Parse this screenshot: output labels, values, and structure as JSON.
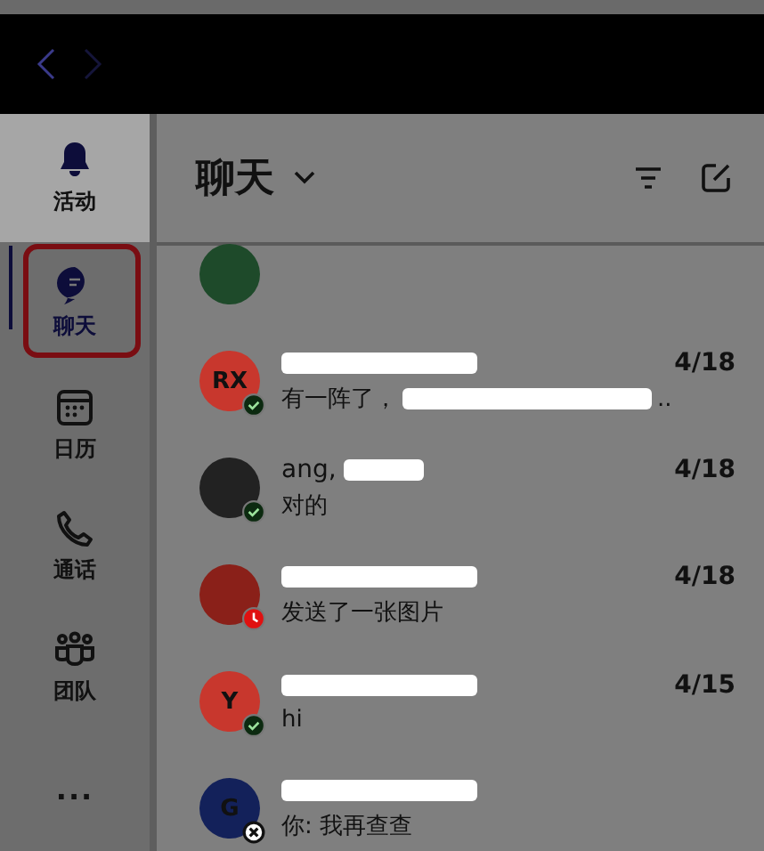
{
  "rail": [
    {
      "kind": "bell",
      "label": "活动",
      "selected": false,
      "highlighted": true
    },
    {
      "kind": "chat",
      "label": "聊天",
      "selected": true,
      "highlighted": false
    },
    {
      "kind": "calendar",
      "label": "日历",
      "selected": false,
      "highlighted": false
    },
    {
      "kind": "phone",
      "label": "通话",
      "selected": false,
      "highlighted": false
    },
    {
      "kind": "team",
      "label": "团队",
      "selected": false,
      "highlighted": false
    },
    {
      "kind": "more",
      "label": "...",
      "selected": false,
      "highlighted": false
    }
  ],
  "header": {
    "title": "聊天"
  },
  "chats": [
    {
      "initials": "RX",
      "color": "#c8372d",
      "badge": {
        "kind": "available"
      },
      "preview": "有一阵了，",
      "preview_tail": "..",
      "date": "4/18"
    },
    {
      "name": "ang,",
      "color": "#222222",
      "badge": {
        "kind": "available"
      },
      "preview": "对的",
      "date": "4/18"
    },
    {
      "color": "#8a2019",
      "badge": {
        "kind": "away"
      },
      "preview": "发送了一张图片",
      "date": "4/18"
    },
    {
      "initials": "Y",
      "color": "#c8372d",
      "badge": {
        "kind": "available"
      },
      "preview": "hi",
      "date": "4/15"
    },
    {
      "initials": "G",
      "color": "#13215a",
      "badge": {
        "kind": "offline"
      },
      "preview": "你: 我再查查"
    }
  ]
}
